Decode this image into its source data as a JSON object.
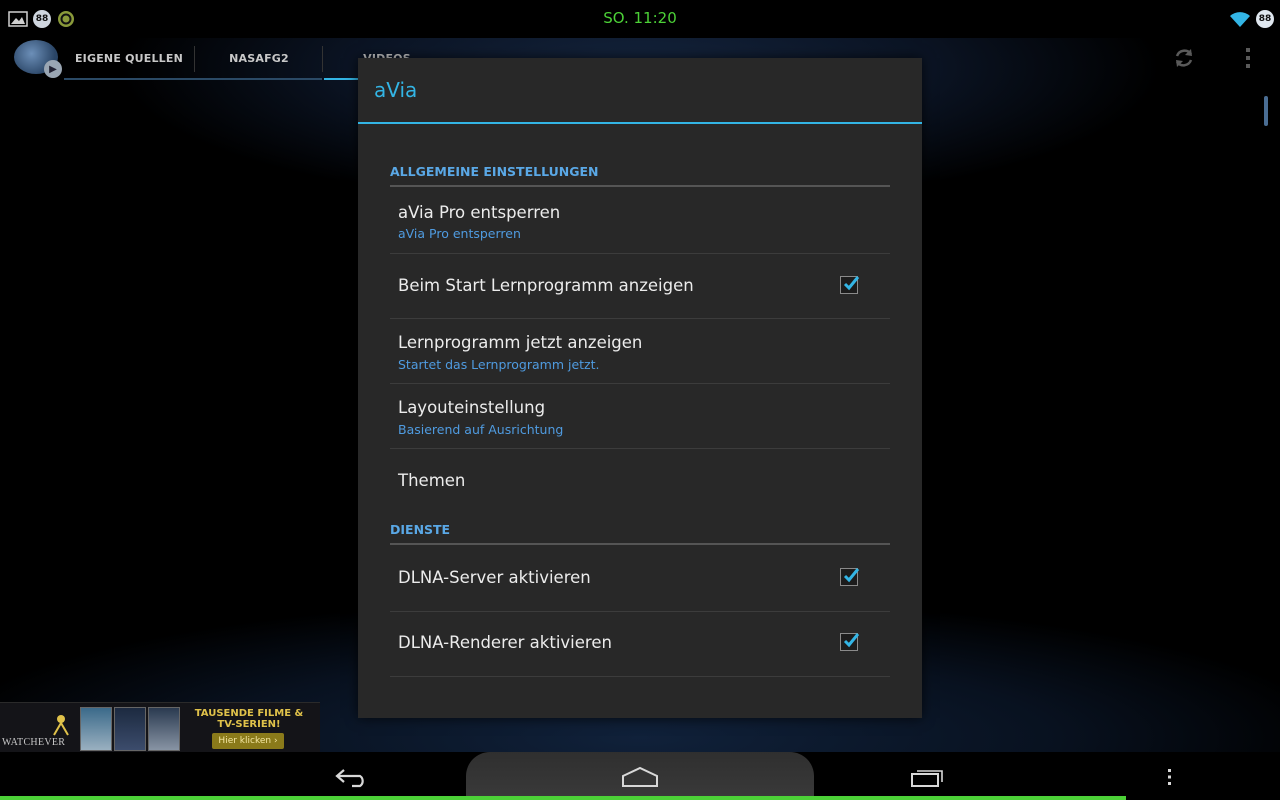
{
  "status_bar": {
    "clock": "SO. 11:20",
    "badge_left": "88",
    "badge_right": "88"
  },
  "action_bar": {
    "tabs": [
      {
        "label": "EIGENE QUELLEN"
      },
      {
        "label": "NASAFG2"
      },
      {
        "label": "VIDEOS"
      }
    ]
  },
  "dialog": {
    "title": "aVia",
    "sections": [
      {
        "header": "ALLGEMEINE EINSTELLUNGEN",
        "items": [
          {
            "title": "aVia Pro entsperren",
            "summary": "aVia Pro entsperren"
          },
          {
            "title": "Beim Start Lernprogramm anzeigen",
            "checked": true
          },
          {
            "title": "Lernprogramm jetzt anzeigen",
            "summary": "Startet das Lernprogramm jetzt."
          },
          {
            "title": "Layouteinstellung",
            "summary": "Basierend auf Ausrichtung"
          },
          {
            "title": "Themen"
          }
        ]
      },
      {
        "header": "DIENSTE",
        "items": [
          {
            "title": "DLNA-Server aktivieren",
            "checked": true
          },
          {
            "title": "DLNA-Renderer aktivieren",
            "checked": true
          }
        ]
      }
    ]
  },
  "ad_banner": {
    "brand": "WATCHEVER",
    "tagline": "TAUSENDE FILME & TV-SERIEN!",
    "cta": "Hier klicken"
  },
  "icons": {
    "status_left": [
      "gallery-icon",
      "notification-badge-icon",
      "sync-app-icon"
    ],
    "status_right": [
      "wifi-icon",
      "battery-badge-icon"
    ],
    "action_bar": [
      "refresh-icon",
      "overflow-menu-icon"
    ],
    "nav_bar": [
      "back-icon",
      "home-icon",
      "recent-apps-icon",
      "menu-icon"
    ]
  },
  "colors": {
    "accent": "#33b5e5",
    "clock": "#4cd137",
    "dialog_bg": "#282828",
    "summary_text": "#4f9be0"
  },
  "system_progress": 0.88
}
